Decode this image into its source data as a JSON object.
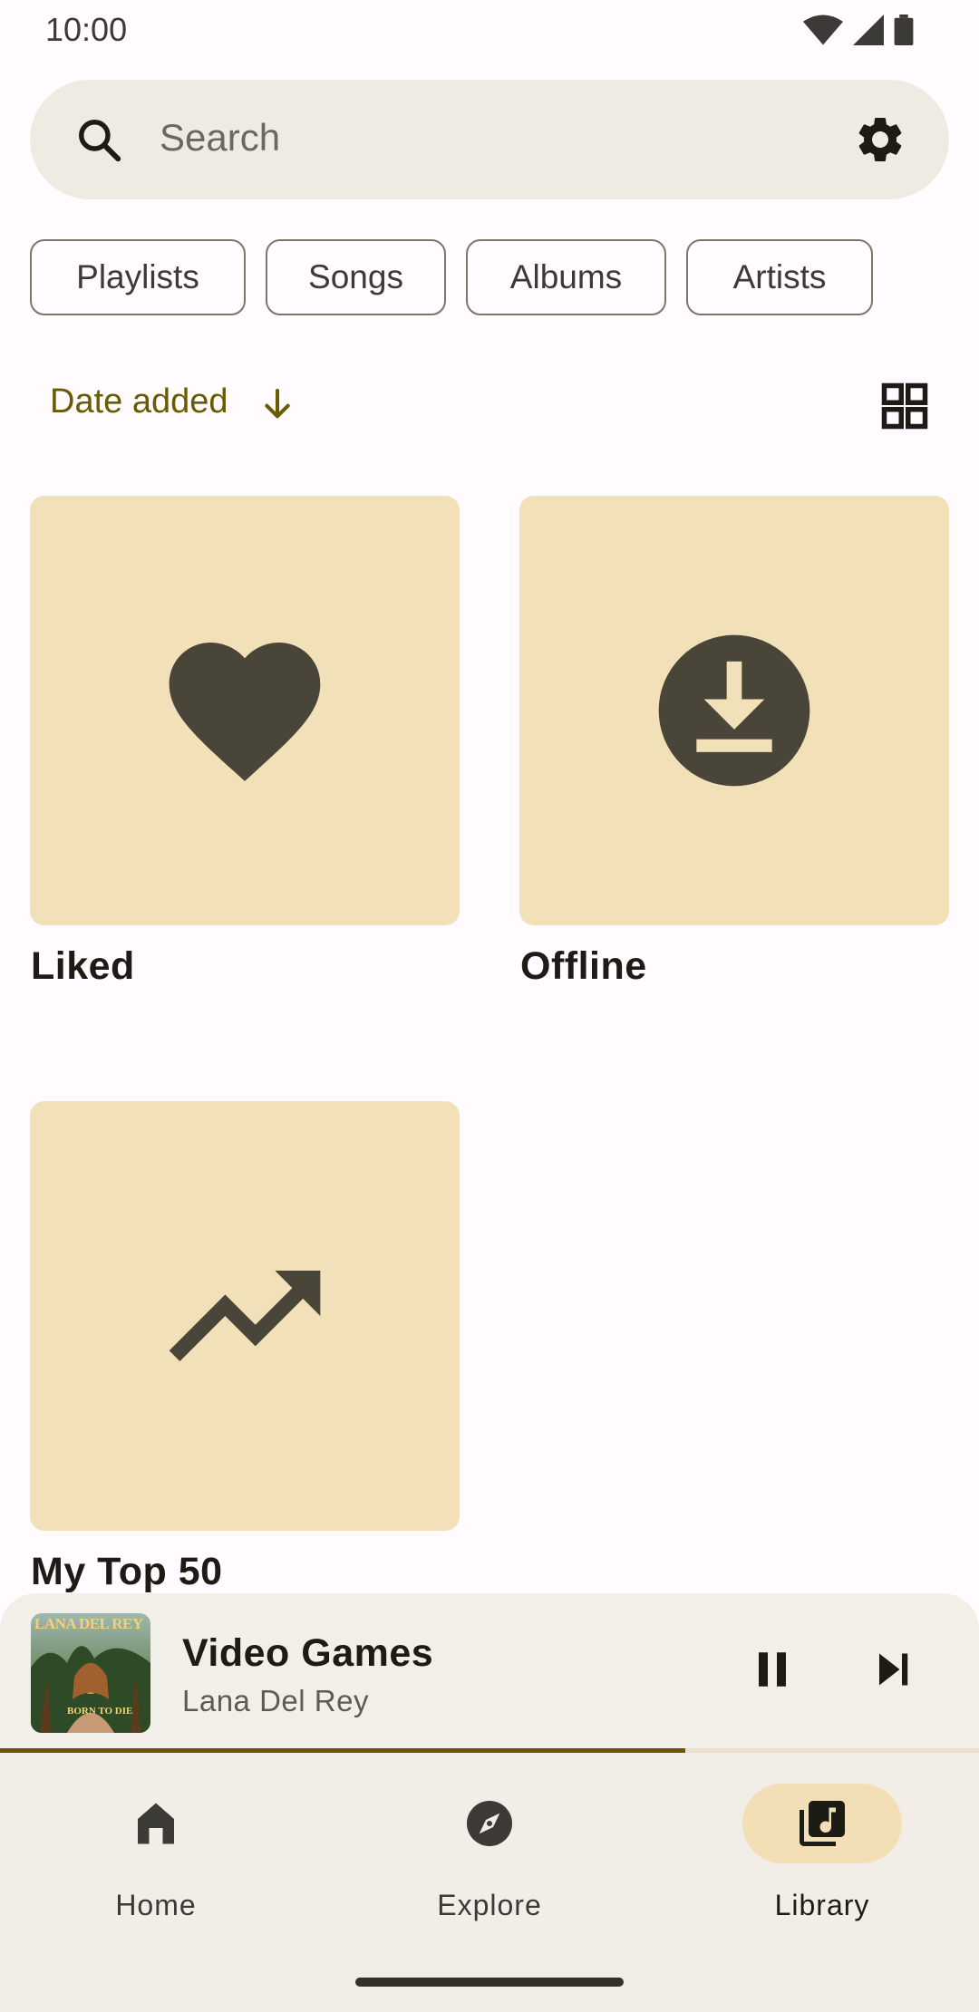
{
  "status_bar": {
    "time": "10:00",
    "icons": [
      "wifi-icon",
      "cell-signal-icon",
      "battery-icon"
    ]
  },
  "search": {
    "placeholder": "Search",
    "settings_icon": "gear-icon"
  },
  "filters": [
    "Playlists",
    "Songs",
    "Albums",
    "Artists"
  ],
  "sort": {
    "label": "Date added",
    "direction_icon": "arrow-down-icon",
    "view_toggle_icon": "grid-view-icon"
  },
  "library": {
    "items": [
      {
        "label": "Liked",
        "icon": "heart-icon"
      },
      {
        "label": "Offline",
        "icon": "download-circle-icon"
      },
      {
        "label": "My Top 50",
        "icon": "trending-up-icon"
      }
    ]
  },
  "player": {
    "title": "Video Games",
    "artist": "Lana Del Rey",
    "progress": 0.7,
    "album_art_text": "LANA DEL REY",
    "album_art_subtext": "BORN TO DIE",
    "controls": [
      "pause-icon",
      "skip-next-icon"
    ]
  },
  "nav": {
    "items": [
      {
        "label": "Home",
        "icon": "home-icon",
        "active": false
      },
      {
        "label": "Explore",
        "icon": "compass-icon",
        "active": false
      },
      {
        "label": "Library",
        "icon": "library-music-icon",
        "active": true
      }
    ]
  },
  "colors": {
    "accent": "#6a5500",
    "tile_background": "#f2e0b8",
    "tile_icon": "#4a4539",
    "surface": "#efebe3",
    "nav_active_pill": "#f2dfb6"
  }
}
